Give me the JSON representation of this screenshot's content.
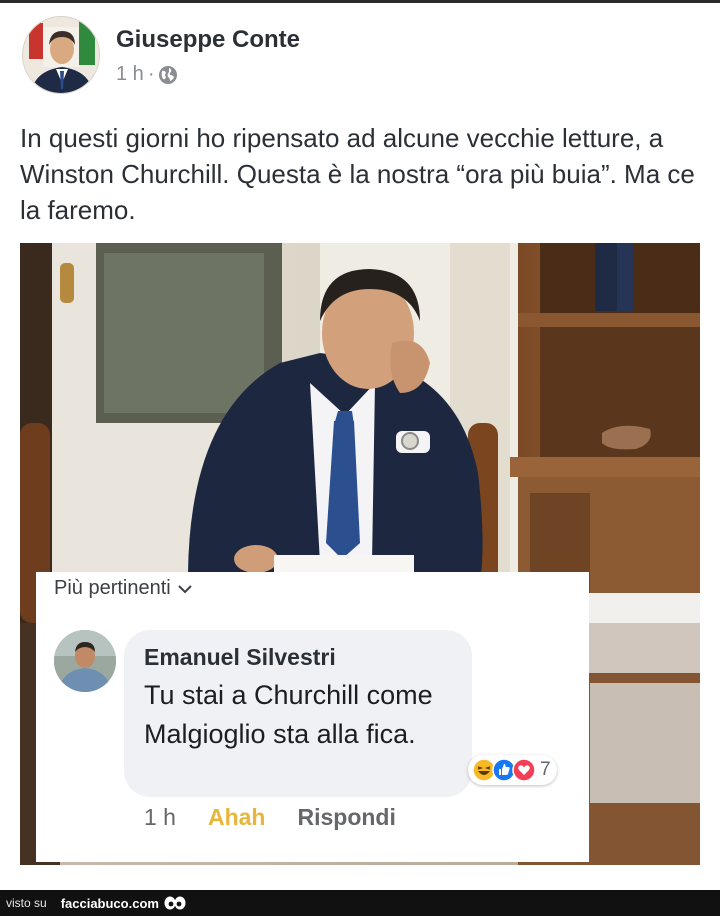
{
  "post": {
    "author": "Giuseppe Conte",
    "time": "1 h",
    "separator": "·",
    "audience_icon": "globe-icon",
    "text": "In questi giorni ho ripensato ad alcune vecchie letture, a Winston Churchill. Questa è la nostra “ora più buia”. Ma ce la faremo."
  },
  "comments": {
    "sort_label": "Più pertinenti",
    "sort_icon": "chevron-down-icon",
    "items": [
      {
        "author": "Emanuel Silvestri",
        "text": "Tu stai a Churchill come Malgioglio sta alla fica.",
        "reactions": {
          "icons": [
            "haha-icon",
            "like-icon",
            "love-icon"
          ],
          "count": "7"
        },
        "time": "1 h",
        "reaction_label": "Ahah",
        "reply_label": "Rispondi"
      }
    ]
  },
  "footer": {
    "prefix": "visto su",
    "site": "facciabuco.com",
    "logo_icon": "eyes-logo-icon"
  },
  "colors": {
    "ahah": "#e8b73a",
    "like": "#1877f2",
    "love": "#f33e58",
    "haha": "#f7b928"
  }
}
